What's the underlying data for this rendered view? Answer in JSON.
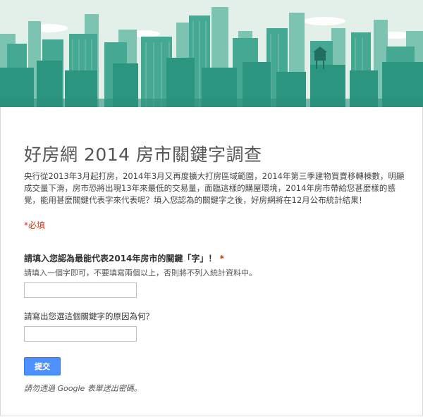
{
  "form": {
    "title": "好房網 2014 房市關鍵字調查",
    "description": "央行從2013年3月起打房，2014年3月又再度擴大打房區域範圍，2014年第三季建物買賣移轉棟數，明顯成交量下滑，房市恐將出現13年來最低的交易量，面臨這樣的購屋環境，2014年房市帶給您甚麼樣的感覺，能用甚麼關鍵代表字來代表呢？填入您認為的關鍵字之後，好房網將在12月公布統計結果！",
    "required_marker": "*",
    "required_note": "必填",
    "question1": {
      "title": "請填入您認為最能代表2014年房市的關鍵「字」！",
      "required_marker": " *",
      "help": "請填入一個字即可，不要填寫兩個以上，否則將不列入統計資料中。",
      "value": ""
    },
    "question2": {
      "title": "請寫出您選這個關鍵字的原因為何？",
      "value": ""
    },
    "submit_label": "提交",
    "password_warning": "請勿透過 Google 表單送出密碼。"
  },
  "colors": {
    "banner_sky": "#e4f1ec",
    "banner_building": "#2f9c86",
    "accent_red": "#c43b1d",
    "submit_blue": "#4d90fe"
  }
}
